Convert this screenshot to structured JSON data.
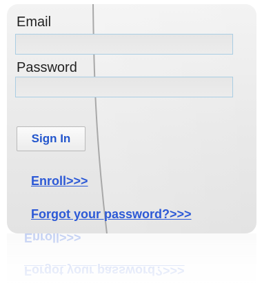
{
  "login": {
    "email_label": "Email",
    "email_value": "",
    "password_label": "Password",
    "password_value": "",
    "sign_in_label": "Sign In",
    "enroll_label": "Enroll>>>",
    "forgot_label": "Forgot your password?>>>"
  },
  "colors": {
    "link": "#2c59d6",
    "field_border": "#a9cde3",
    "panel": "#e9e9e9"
  }
}
